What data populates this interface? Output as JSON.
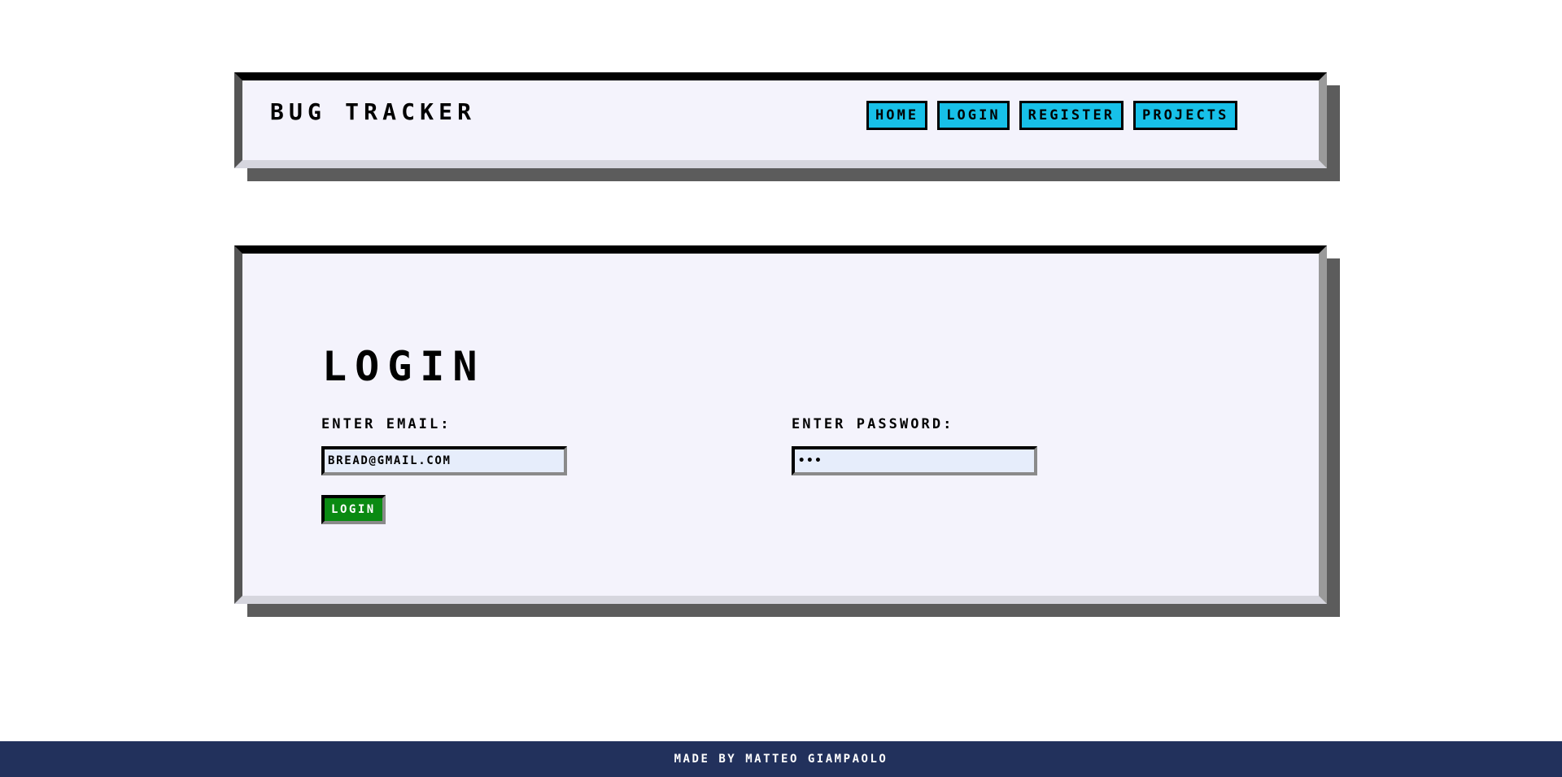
{
  "header": {
    "brand": "BUG TRACKER",
    "nav": [
      {
        "label": "HOME"
      },
      {
        "label": "LOGIN"
      },
      {
        "label": "REGISTER"
      },
      {
        "label": "PROJECTS"
      }
    ]
  },
  "login": {
    "title": "LOGIN",
    "email_label": "ENTER EMAIL:",
    "email_value": "BREAD@GMAIL.COM",
    "password_label": "ENTER PASSWORD:",
    "password_value": "•••",
    "submit_label": "LOGIN"
  },
  "footer": {
    "text": "MADE BY MATTEO GIAMPAOLO"
  },
  "colors": {
    "nav_button": "#17c0e8",
    "login_button": "#0a8a12",
    "footer_bg": "#22315c",
    "panel_bg": "#f4f3fc"
  }
}
